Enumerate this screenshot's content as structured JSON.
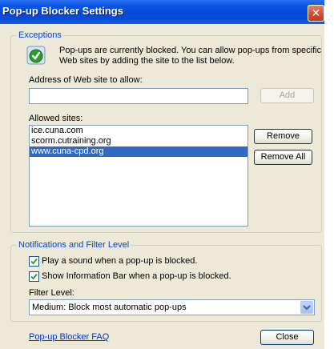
{
  "window": {
    "title": "Pop-up Blocker Settings",
    "close_glyph": "✕"
  },
  "exceptions": {
    "legend": "Exceptions",
    "info_line1": "Pop-ups are currently blocked.  You can allow pop-ups from specific",
    "info_line2": "Web sites by adding the site to the list below.",
    "address_label": "Address of Web site to allow:",
    "address_value": "",
    "add_label": "Add",
    "allowed_label": "Allowed sites:",
    "sites": [
      "ice.cuna.com",
      "scorm.cutraining.org",
      "www.cuna-cpd.org"
    ],
    "selected_site": "www.cuna-cpd.org",
    "remove_label": "Remove",
    "remove_all_label": "Remove All"
  },
  "notifications": {
    "legend": "Notifications and Filter Level",
    "play_sound_label": "Play a sound when a pop-up is blocked.",
    "play_sound_checked": true,
    "info_bar_label": "Show Information Bar when a pop-up is blocked.",
    "info_bar_checked": true,
    "filter_label": "Filter Level:",
    "filter_value": "Medium: Block most automatic pop-ups"
  },
  "footer": {
    "faq_link": "Pop-up Blocker FAQ",
    "close_label": "Close"
  },
  "icons": {
    "info": "shield-check-icon",
    "dropdown": "chevron-down-icon",
    "check": "checkmark-icon"
  },
  "colors": {
    "titlebar": "#0a54e3",
    "selection": "#316ac5",
    "legend": "#0046d5",
    "dialog_bg": "#ece9d8"
  }
}
